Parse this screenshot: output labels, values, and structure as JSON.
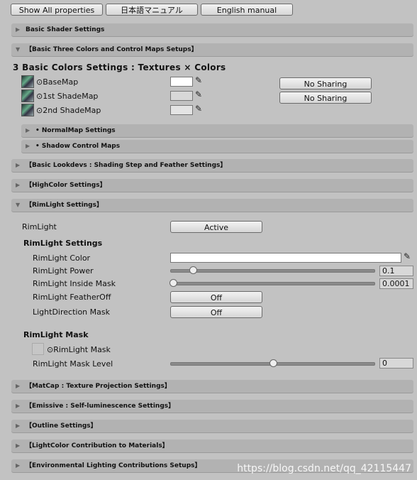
{
  "toolbar": {
    "show_all": "Show All properties",
    "jp_manual": "日本語マニュアル",
    "en_manual": "English manual"
  },
  "sections": {
    "basic_shader": "Basic Shader Settings",
    "basic_three": "【Basic Three Colors and Control Maps Setups】",
    "normalmap": "• NormalMap Settings",
    "shadow": "• Shadow Control Maps",
    "lookdevs": "【Basic Lookdevs : Shading Step and Feather Settings】",
    "highcolor": "【HighColor Settings】",
    "rimlight": "【RimLight Settings】",
    "matcap": "【MatCap : Texture Projection Settings】",
    "emissive": "【Emissive : Self-luminescence Settings】",
    "outline": "【Outline Settings】",
    "lightcolor": "【LightColor Contribution to Materials】",
    "environmental": "【Environmental Lighting Contributions Setups】"
  },
  "basic_colors": {
    "title": "3 Basic Colors Settings : Textures × Colors",
    "maps": [
      {
        "label": "⊙BaseMap",
        "color": "#ffffff"
      },
      {
        "label": "⊙1st ShadeMap",
        "color": "#d8d8d8"
      },
      {
        "label": "⊙2nd ShadeMap",
        "color": "#e4e4e4"
      }
    ],
    "sharing": [
      "No Sharing",
      "No Sharing"
    ]
  },
  "rimlight": {
    "label": "RimLight",
    "toggle": "Active",
    "settings_title": "RimLight Settings",
    "color_label": "RimLight Color",
    "color": "#ffffff",
    "power_label": "RimLight Power",
    "power": "0.1",
    "inside_label": "RimLight Inside Mask",
    "inside": "0.0001",
    "featheroff_label": "RimLight FeatherOff",
    "featheroff": "Off",
    "lightdir_label": "LightDirection Mask",
    "lightdir": "Off",
    "mask_title": "RimLight Mask",
    "mask_tex": "⊙RimLight Mask",
    "mask_level_label": "RimLight Mask Level",
    "mask_level": "0"
  },
  "watermark": "https://blog.csdn.net/qq_42115447"
}
